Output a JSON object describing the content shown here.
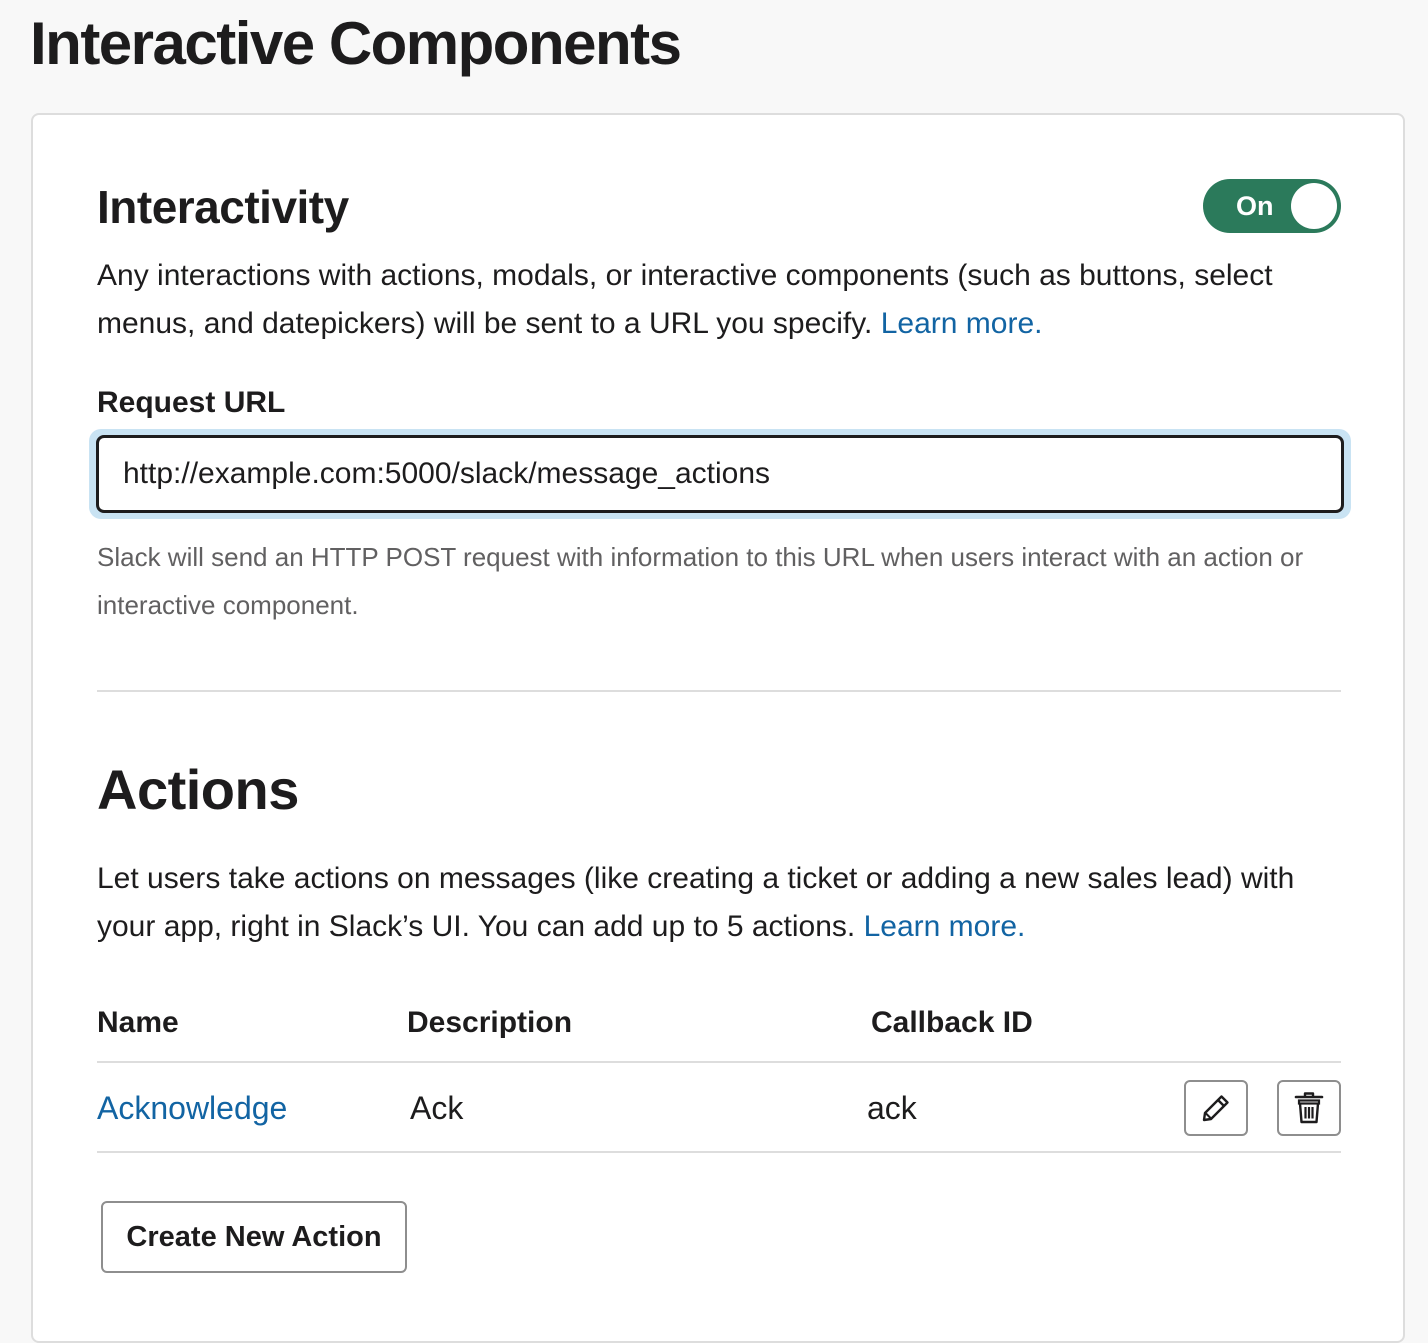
{
  "page": {
    "title": "Interactive Components"
  },
  "interactivity": {
    "title": "Interactivity",
    "toggle_label": "On",
    "toggle_on": true,
    "toggle_color": "#2b7a5b",
    "description": "Any interactions with actions, modals, or interactive components (such as buttons, select menus, and datepickers) will be sent to a URL you specify.",
    "learn_more": "Learn more.",
    "request_url_label": "Request URL",
    "request_url_value": "http://example.com:5000/slack/message_actions",
    "hint": "Slack will send an HTTP POST request with information to this URL when users interact with an action or interactive component."
  },
  "actions": {
    "title": "Actions",
    "description": "Let users take actions on messages (like creating a ticket or adding a new sales lead) with your app, right in Slack’s UI. You can add up to 5 actions.",
    "learn_more": "Learn more.",
    "columns": {
      "name": "Name",
      "description": "Description",
      "callback_id": "Callback ID"
    },
    "rows": [
      {
        "name": "Acknowledge",
        "description": "Ack",
        "callback_id": "ack",
        "edit_icon": "pencil-icon",
        "delete_icon": "trash-icon"
      }
    ],
    "create_button": "Create New Action"
  },
  "colors": {
    "link": "#1264a3",
    "text": "#1d1c1d",
    "muted": "#616061",
    "focus_ring": "#c9e3f3"
  }
}
